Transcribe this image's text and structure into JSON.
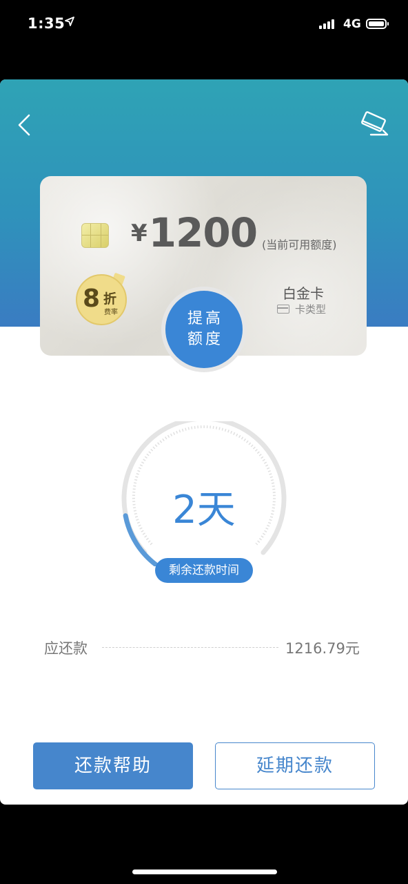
{
  "status_bar": {
    "time": "1:35",
    "network": "4G"
  },
  "card": {
    "currency": "¥",
    "amount": "1200",
    "amount_caption": "(当前可用额度)",
    "discount_number": "8",
    "discount_unit": "折",
    "discount_caption": "费率",
    "type_name": "白金卡",
    "type_label": "卡类型"
  },
  "raise_button": {
    "line1": "提高",
    "line2": "额度"
  },
  "countdown": {
    "value": "2天",
    "label": "剩余还款时间",
    "elapsed_fraction": 0.15
  },
  "due": {
    "label": "应还款",
    "value": "1216.79元"
  },
  "actions": {
    "help_label": "还款帮助",
    "extend_label": "延期还款"
  },
  "colors": {
    "primary": "#3a86d6",
    "header_top": "#2fa3b5",
    "header_bottom": "#3a7cc2"
  },
  "icons": {
    "back": "chevron-left-icon",
    "card_action": "card-edit-icon",
    "location": "location-arrow-icon"
  }
}
